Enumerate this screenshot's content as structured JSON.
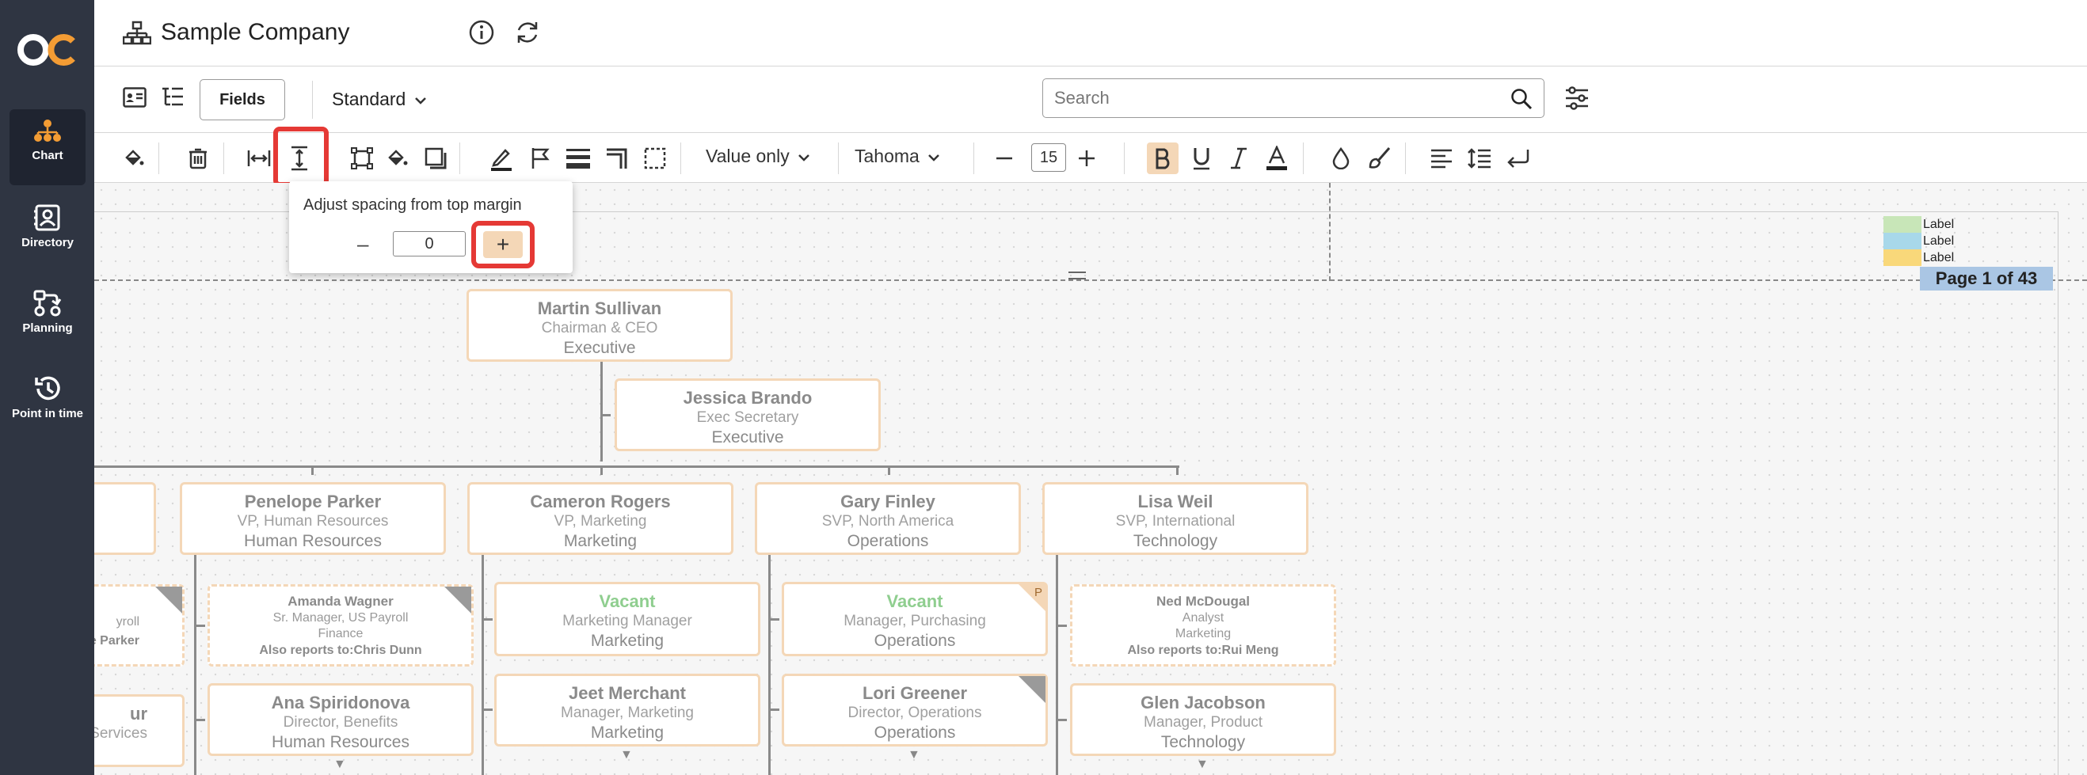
{
  "sidebar": {
    "logo_text": "OC",
    "items": [
      {
        "label": "Chart",
        "icon": "org-chart-icon",
        "active": true
      },
      {
        "label": "Directory",
        "icon": "directory-icon",
        "active": false
      },
      {
        "label": "Planning",
        "icon": "planning-icon",
        "active": false
      },
      {
        "label": "Point in time",
        "icon": "history-icon",
        "active": false
      }
    ]
  },
  "header": {
    "title": "Sample Company"
  },
  "view_toolbar": {
    "fields_label": "Fields",
    "layout_select": "Standard",
    "search_placeholder": "Search"
  },
  "format_toolbar": {
    "value_mode": "Value only",
    "font_family": "Tahoma",
    "font_size": "15",
    "bold_active": true
  },
  "popup": {
    "label": "Adjust spacing from top margin",
    "value": "0",
    "minus": "–",
    "plus": "+"
  },
  "canvas": {
    "legend": [
      {
        "label": "Label",
        "color": "#c8e6b8"
      },
      {
        "label": "Label",
        "color": "#a8d8ea"
      },
      {
        "label": "Label",
        "color": "#f9d87a"
      }
    ],
    "page_indicator": "Page 1 of 43"
  },
  "org": {
    "ceo": {
      "name": "Martin Sullivan",
      "role": "Chairman & CEO",
      "dept": "Executive"
    },
    "assistant": {
      "name": "Jessica Brando",
      "role": "Exec Secretary",
      "dept": "Executive"
    },
    "level2": [
      {
        "name": "",
        "role": "",
        "dept": ""
      },
      {
        "name": "Penelope Parker",
        "role": "VP, Human Resources",
        "dept": "Human Resources"
      },
      {
        "name": "Cameron Rogers",
        "role": "VP, Marketing",
        "dept": "Marketing"
      },
      {
        "name": "Gary Finley",
        "role": "SVP, North America",
        "dept": "Operations"
      },
      {
        "name": "Lisa Weil",
        "role": "SVP, International",
        "dept": "Technology"
      }
    ],
    "partial_left_a": {
      "role": "yroll",
      "also": "pe Parker"
    },
    "partial_left_b": {
      "name": "ur",
      "role": "Services"
    },
    "amanda": {
      "name": "Amanda Wagner",
      "role": "Sr. Manager, US Payroll",
      "dept": "Finance",
      "also": "Also reports to:Chris  Dunn"
    },
    "ana": {
      "name": "Ana Spiridonova",
      "role": "Director, Benefits",
      "dept": "Human Resources"
    },
    "vacant_mkt": {
      "name": "Vacant",
      "role": "Marketing Manager",
      "dept": "Marketing"
    },
    "jeet": {
      "name": "Jeet Merchant",
      "role": "Manager, Marketing",
      "dept": "Marketing"
    },
    "vacant_ops": {
      "name": "Vacant",
      "role": "Manager, Purchasing",
      "dept": "Operations",
      "badge": "P"
    },
    "lori": {
      "name": "Lori Greener",
      "role": "Director, Operations",
      "dept": "Operations"
    },
    "ned": {
      "name": "Ned McDougal",
      "role": "Analyst",
      "dept": "Marketing",
      "also": "Also reports to:Rui Meng"
    },
    "glen": {
      "name": "Glen Jacobson",
      "role": "Manager, Product",
      "dept": "Technology"
    }
  }
}
